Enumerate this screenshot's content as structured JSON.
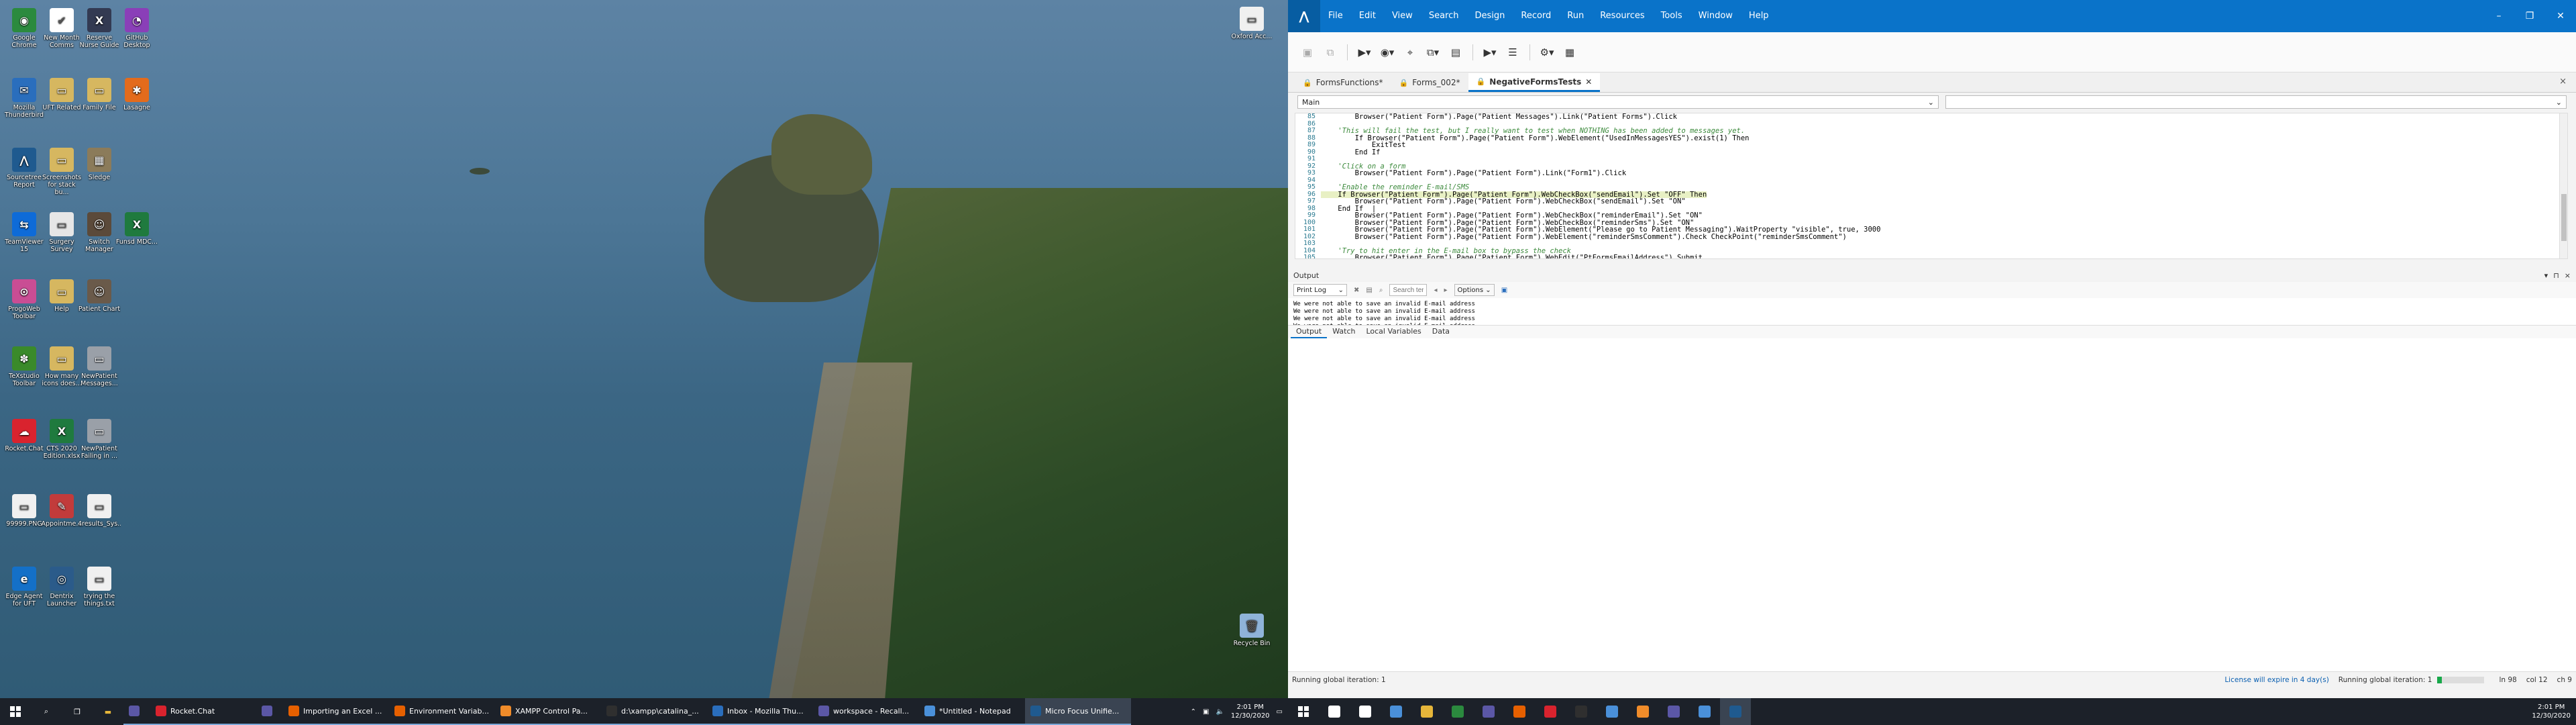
{
  "left_monitor": {
    "desktop_icons": [
      {
        "label": "Google Chrome",
        "glyph": "◉",
        "color": "#2b8a3e"
      },
      {
        "label": "New Month Comms",
        "glyph": "✔",
        "color": "#ffffff"
      },
      {
        "label": "Reserve Nurse Guide",
        "glyph": "X",
        "color": "#333a52"
      },
      {
        "label": "GitHub Desktop",
        "glyph": "◔",
        "color": "#8a3fb8"
      },
      {
        "label": "Mozilla Thunderbird",
        "glyph": "✉",
        "color": "#2a6ebd"
      },
      {
        "label": "UFT Related",
        "glyph": "▭",
        "color": "#d6b760"
      },
      {
        "label": "Family File",
        "glyph": "▭",
        "color": "#d6b760"
      },
      {
        "label": "Lasagne",
        "glyph": "✱",
        "color": "#e36b1c"
      },
      {
        "label": "Sourcetree Report",
        "glyph": "⋀",
        "color": "#1f5a8f"
      },
      {
        "label": "Screenshots for stack bu...",
        "glyph": "▭",
        "color": "#d6b760"
      },
      {
        "label": "Sledge",
        "glyph": "▦",
        "color": "#8b7b5a"
      },
      {
        "label": "TeamViewer 15",
        "glyph": "⇆",
        "color": "#0e6bd8"
      },
      {
        "label": "Surgery Survey",
        "glyph": "▭",
        "color": "#e6e6e6"
      },
      {
        "label": "Switch Manager",
        "glyph": "☺",
        "color": "#5b4a3a"
      },
      {
        "label": "Funsd MDC...",
        "glyph": "X",
        "color": "#1f7a3e"
      },
      {
        "label": "ProgoWeb Toolbar",
        "glyph": "⊙",
        "color": "#c94d94"
      },
      {
        "label": "Help",
        "glyph": "▭",
        "color": "#d6b760"
      },
      {
        "label": "Patient Chart",
        "glyph": "☺",
        "color": "#6a5a4a"
      },
      {
        "label": "TeXstudio Toolbar",
        "glyph": "✽",
        "color": "#3a8a2a"
      },
      {
        "label": "How many icons does...",
        "glyph": "▭",
        "color": "#d6b760"
      },
      {
        "label": "NewPatient Messages...",
        "glyph": "▭",
        "color": "#9aa0a8"
      },
      {
        "label": "Rocket.Chat",
        "glyph": "☁",
        "color": "#d9232e"
      },
      {
        "label": "CTS 2020 Edition.xlsx",
        "glyph": "X",
        "color": "#1f7a3e"
      },
      {
        "label": "NewPatient Failing in ...",
        "glyph": "▭",
        "color": "#9aa0a8"
      },
      {
        "label": "99999.PNG",
        "glyph": "▭",
        "color": "#f0f0f0"
      },
      {
        "label": "Appointme...",
        "glyph": "✎",
        "color": "#c23b3b"
      },
      {
        "label": "4results_Sys...",
        "glyph": "▭",
        "color": "#f0f0f0"
      },
      {
        "label": "Edge Agent for UFT",
        "glyph": "e",
        "color": "#1470c8"
      },
      {
        "label": "Dentrix Launcher",
        "glyph": "◎",
        "color": "#2b5b8a"
      },
      {
        "label": "trying the things.txt",
        "glyph": "▭",
        "color": "#f0f0f0"
      },
      {
        "label": "Micro Focus Unified Fu...",
        "glyph": "⋀",
        "color": "#1f5a8f"
      },
      {
        "label": "Dentrix Relea...",
        "glyph": "✎",
        "color": "#2b5b8a"
      },
      {
        "label": "aaaaaaa.txt",
        "glyph": "▭",
        "color": "#f0f0f0"
      }
    ],
    "right_icons": [
      {
        "label": "Oxford Acc...",
        "glyph": "▭",
        "color": "#f0f0f0"
      },
      {
        "label": "Recycle Bin",
        "glyph": "🗑",
        "color": "#8fb3d9"
      }
    ],
    "taskbar": {
      "tasks": [
        {
          "label": "",
          "color": "#5b57a6"
        },
        {
          "label": "Rocket.Chat",
          "color": "#d9232e"
        },
        {
          "label": "",
          "color": "#5b57a6"
        },
        {
          "label": "Importing an Excel ...",
          "color": "#e66000"
        },
        {
          "label": "Environment Variab...",
          "color": "#e66000"
        },
        {
          "label": "XAMPP Control Pa...",
          "color": "#f08c2a"
        },
        {
          "label": "d:\\xampp\\catalina_...",
          "color": "#2f2f2f"
        },
        {
          "label": "Inbox - Mozilla Thu...",
          "color": "#2a6ebd"
        },
        {
          "label": "workspace - Recall...",
          "color": "#5b57a6"
        },
        {
          "label": "*Untitled - Notepad",
          "color": "#4a90d9"
        },
        {
          "label": "Micro Focus Unifie...",
          "color": "#1f5a8f"
        }
      ],
      "time": "2:01 PM",
      "date": "12/30/2020"
    }
  },
  "uft": {
    "menu": [
      "File",
      "Edit",
      "View",
      "Search",
      "Design",
      "Record",
      "Run",
      "Resources",
      "Tools",
      "Window",
      "Help"
    ],
    "doc_tabs": [
      {
        "label": "FormsFunctions*",
        "active": false
      },
      {
        "label": "Forms_002*",
        "active": false
      },
      {
        "label": "NegativeFormsTests",
        "active": true
      }
    ],
    "scope_combo": "Main",
    "code_lines": [
      {
        "n": "85",
        "text": "        Browser(\"Patient Form\").Page(\"Patient Messages\").Link(\"Patient Forms\").Click",
        "type": "code"
      },
      {
        "n": "86",
        "text": "",
        "type": "code"
      },
      {
        "n": "87",
        "text": "    'This will fail the test, but I really want to test when NOTHING has been added to messages yet.",
        "type": "comment"
      },
      {
        "n": "88",
        "text": "        If Browser(\"Patient Form\").Page(\"Patient Form\").WebElement(\"UsedInMessagesYES\").exist(1) Then",
        "type": "code"
      },
      {
        "n": "89",
        "text": "            ExitTest",
        "type": "code"
      },
      {
        "n": "90",
        "text": "        End If",
        "type": "code"
      },
      {
        "n": "91",
        "text": "",
        "type": "code"
      },
      {
        "n": "92",
        "text": "    'Click on a form",
        "type": "comment"
      },
      {
        "n": "93",
        "text": "        Browser(\"Patient Form\").Page(\"Patient Form\").Link(\"Form1\").Click",
        "type": "code"
      },
      {
        "n": "94",
        "text": "",
        "type": "code"
      },
      {
        "n": "95",
        "text": "    'Enable the reminder E-mail/SMS",
        "type": "comment"
      },
      {
        "n": "96",
        "text": "    If Browser(\"Patient Form\").Page(\"Patient Form\").WebCheckBox(\"sendEmail\").Set \"OFF\" Then",
        "type": "highlight"
      },
      {
        "n": "97",
        "text": "        Browser(\"Patient Form\").Page(\"Patient Form\").WebCheckBox(\"sendEmail\").Set \"ON\"",
        "type": "code"
      },
      {
        "n": "98",
        "text": "    End If  |",
        "type": "code"
      },
      {
        "n": "99",
        "text": "        Browser(\"Patient Form\").Page(\"Patient Form\").WebCheckBox(\"reminderEmail\").Set \"ON\"",
        "type": "code"
      },
      {
        "n": "100",
        "text": "        Browser(\"Patient Form\").Page(\"Patient Form\").WebCheckBox(\"reminderSms\").Set \"ON\"",
        "type": "code"
      },
      {
        "n": "101",
        "text": "        Browser(\"Patient Form\").Page(\"Patient Form\").WebElement(\"Please go to Patient Messaging\").WaitProperty \"visible\", true, 3000",
        "type": "code"
      },
      {
        "n": "102",
        "text": "        Browser(\"Patient Form\").Page(\"Patient Form\").WebElement(\"reminderSmsComment\").Check CheckPoint(\"reminderSmsComment\")",
        "type": "code"
      },
      {
        "n": "103",
        "text": "",
        "type": "code"
      },
      {
        "n": "104",
        "text": "    'Try to hit enter in the E-mail box to bypass the check",
        "type": "comment"
      },
      {
        "n": "105",
        "text": "        Browser(\"Patient Form\").Page(\"Patient Form\").WebEdit(\"PtFormsEmailAddress\").Submit",
        "type": "code"
      },
      {
        "n": "106",
        "text": "",
        "type": "code"
      },
      {
        "n": "107",
        "text": "    'Make sure it fails",
        "type": "comment"
      },
      {
        "n": "108",
        "text": "        Browser(\"Patient Form\").Page(\"Page\").WebElement(\"{\"status\":\"fail\",\"errorMap\":{}_2\").Check CheckPoint(\"{\"status\":\"fail\",\"errorMap\":{},\"pageErrorList\":[\"Reminder - Increase Text Limit required.\"]}\")",
        "type": "code"
      },
      {
        "n": "109",
        "text": "",
        "type": "code"
      },
      {
        "n": "110",
        "text": "    'Back to patient forms",
        "type": "comment"
      },
      {
        "n": "111",
        "text": "        Browser(\"Patient Form\").Page(\"Page\").Sync",
        "type": "code"
      },
      {
        "n": "112",
        "text": "        Browser(\"Patient Form\").Back",
        "type": "code"
      },
      {
        "n": "113",
        "text": "",
        "type": "code"
      }
    ],
    "output": {
      "title": "Output",
      "combo": "Print Log",
      "search_placeholder": "Search term",
      "options_label": "Options",
      "lines": [
        "We were not able to save an invalid E-mail address",
        "We were not able to save an invalid E-mail address",
        "We were not able to save an invalid E-mail address",
        "We were not able to save an invalid E-mail address",
        "We were not able to save an invalid E-mail address"
      ],
      "tabs": [
        "Output",
        "Watch",
        "Local Variables",
        "Data"
      ]
    },
    "status": {
      "left": "Running global iteration: 1",
      "license": "License will expire in 4 day(s)",
      "right": "Running global iteration: 1",
      "progress": 0.1,
      "ln": "ln 98",
      "col": "col 12",
      "ch": "ch 9"
    },
    "taskbar": {
      "icons": [
        {
          "color": "#ffffff"
        },
        {
          "color": "#ffffff"
        },
        {
          "color": "#4a90d9"
        },
        {
          "color": "#e6b63a"
        },
        {
          "color": "#2b8a3e"
        },
        {
          "color": "#5b57a6"
        },
        {
          "color": "#e66000"
        },
        {
          "color": "#d9232e"
        },
        {
          "color": "#2f2f2f"
        },
        {
          "color": "#4a90d9"
        },
        {
          "color": "#f08c2a"
        },
        {
          "color": "#5b57a6"
        },
        {
          "color": "#4a90d9"
        },
        {
          "color": "#1f5a8f"
        }
      ],
      "time": "2:01 PM",
      "date": "12/30/2020"
    }
  }
}
